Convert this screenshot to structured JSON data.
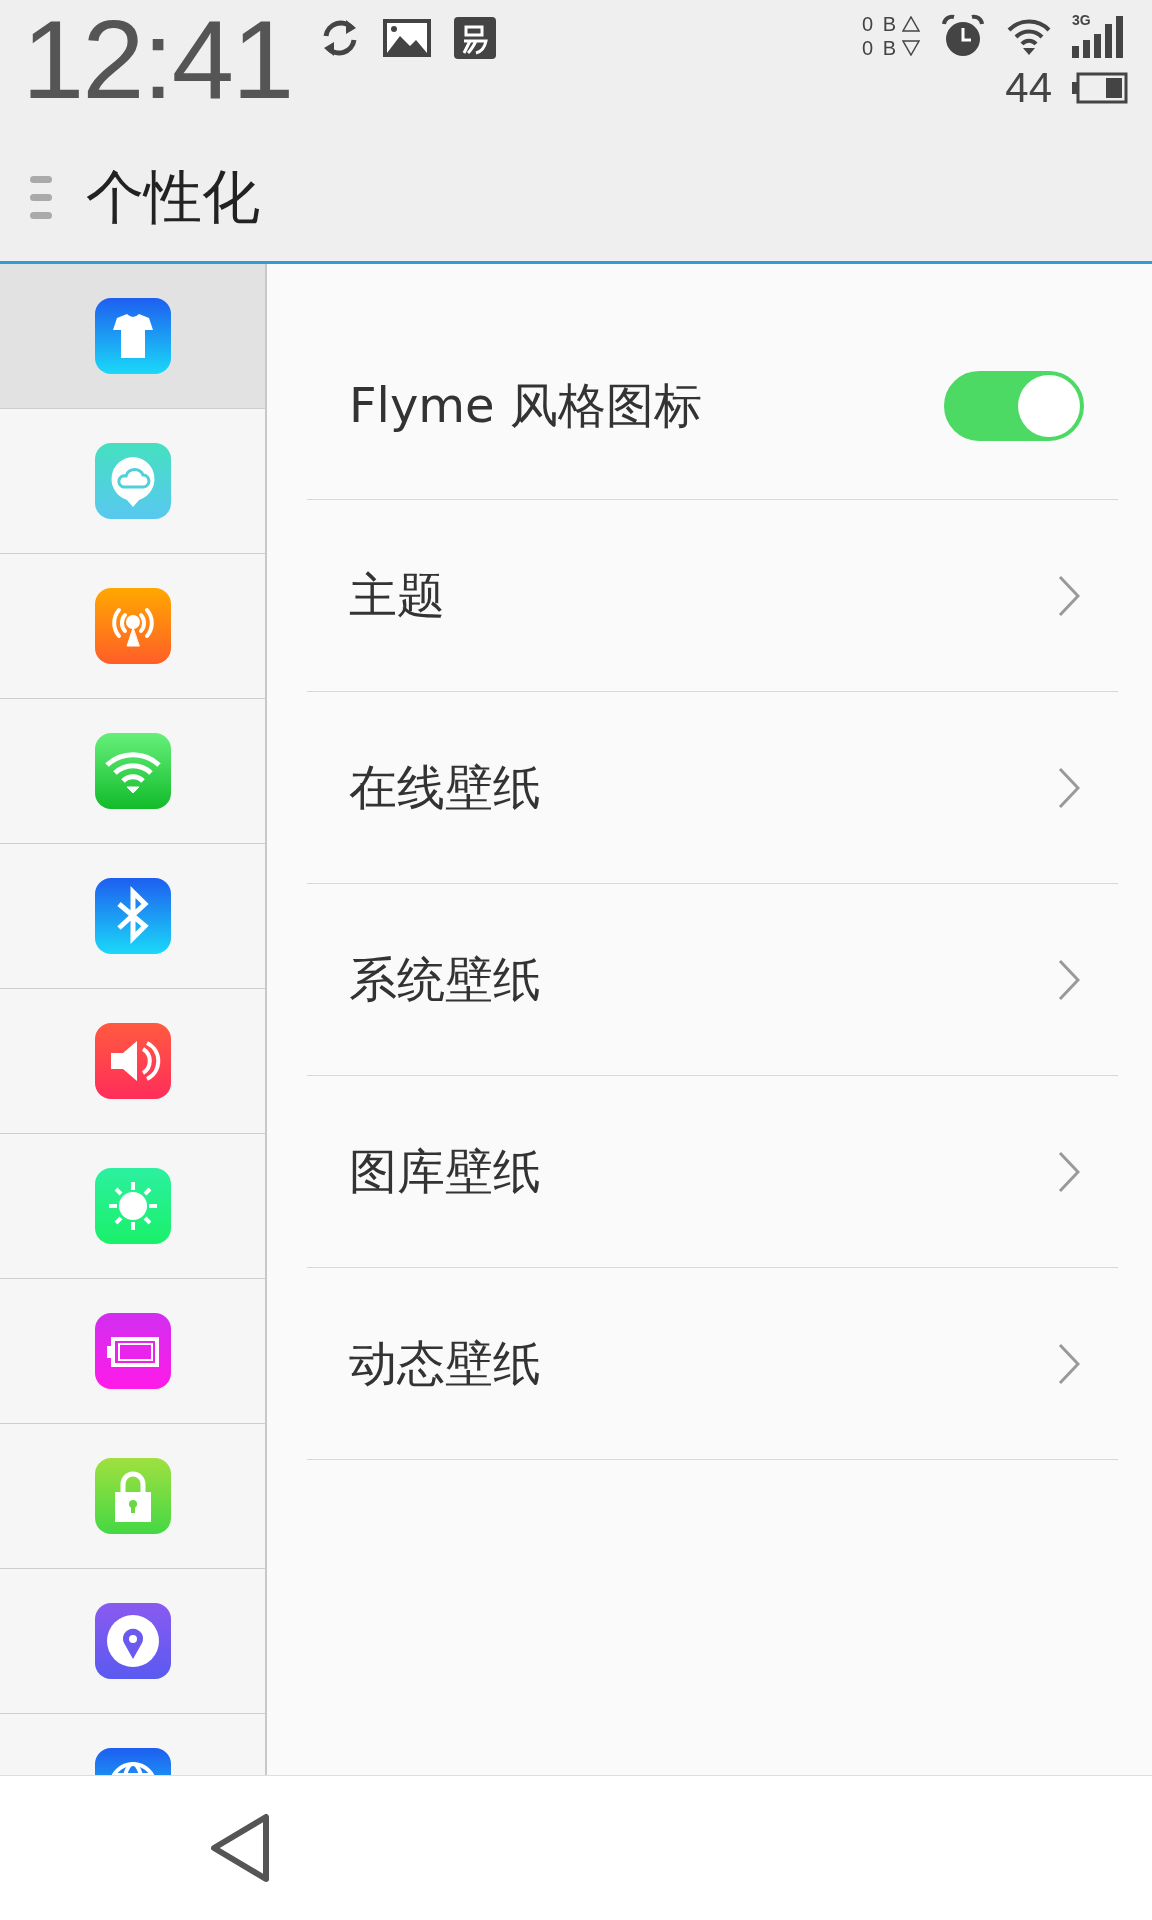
{
  "status_bar": {
    "time": "12:41",
    "net_up": "0 B",
    "net_down": "0 B",
    "network_type": "3G",
    "battery": "44"
  },
  "header": {
    "title": "个性化"
  },
  "sidebar": {
    "items": [
      {
        "kind": "tshirt",
        "selected": true
      },
      {
        "kind": "cloud",
        "selected": false
      },
      {
        "kind": "hotspot",
        "selected": false
      },
      {
        "kind": "wifi",
        "selected": false
      },
      {
        "kind": "bluetooth",
        "selected": false
      },
      {
        "kind": "sound",
        "selected": false
      },
      {
        "kind": "brightness",
        "selected": false
      },
      {
        "kind": "battery",
        "selected": false
      },
      {
        "kind": "lock",
        "selected": false
      },
      {
        "kind": "location",
        "selected": false
      },
      {
        "kind": "globe",
        "selected": false
      }
    ]
  },
  "settings": [
    {
      "kind": "toggle",
      "label": "Flyme 风格图标",
      "on": true
    },
    {
      "kind": "link",
      "label": "主题"
    },
    {
      "kind": "link",
      "label": "在线壁纸"
    },
    {
      "kind": "link",
      "label": "系统壁纸"
    },
    {
      "kind": "link",
      "label": "图库壁纸"
    },
    {
      "kind": "link",
      "label": "动态壁纸"
    }
  ]
}
